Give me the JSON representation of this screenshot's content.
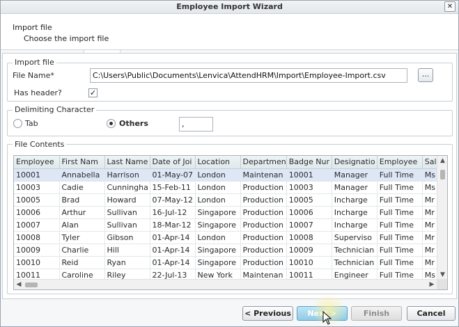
{
  "window": {
    "title": "Employee Import Wizard",
    "close_glyph": "✕"
  },
  "header": {
    "title": "Import file",
    "subtitle": "Choose the import file"
  },
  "import_file": {
    "group_label": "Import file",
    "file_name_label": "File Name*",
    "file_name_value": "C:\\Users\\Public\\Documents\\Lenvica\\AttendHRM\\Import\\Employee-Import.csv",
    "browse_label": "...",
    "has_header_label": "Has header?",
    "has_header_checked": true
  },
  "delimiter": {
    "group_label": "Delimiting Character",
    "tab_label": "Tab",
    "others_label": "Others",
    "selected": "Others",
    "others_value": ","
  },
  "file_contents": {
    "group_label": "File Contents",
    "columns": [
      "Employee",
      "First Nam",
      "Last Name",
      "Date of Joi",
      "Location",
      "Departmen",
      "Badge Nur",
      "Designatio",
      "Employee",
      "Sal"
    ],
    "rows": [
      [
        "10001",
        "Annabella",
        "Harrison",
        "01-May-07",
        "London",
        "Maintenan",
        "10001",
        "Manager",
        "Full Time",
        "Ms"
      ],
      [
        "10003",
        "Cadie",
        "Cunningha",
        "15-Feb-11",
        "London",
        "Production",
        "10003",
        "Manager",
        "Full Time",
        "Ms"
      ],
      [
        "10005",
        "Brad",
        "Howard",
        "07-May-12",
        "London",
        "Production",
        "10005",
        "Incharge",
        "Full Time",
        "Mr"
      ],
      [
        "10006",
        "Arthur",
        "Sullivan",
        "16-Jul-12",
        "Singapore",
        "Production",
        "10006",
        "Incharge",
        "Full Time",
        "Mr"
      ],
      [
        "10007",
        "Alan",
        "Sullivan",
        "18-Mar-12",
        "Singapore",
        "Production",
        "10007",
        "Incharge",
        "Full Time",
        "Mr"
      ],
      [
        "10008",
        "Tyler",
        "Gibson",
        "01-Apr-14",
        "London",
        "Production",
        "10008",
        "Superviso",
        "Full Time",
        "Mr"
      ],
      [
        "10009",
        "Charlie",
        "Hill",
        "01-Apr-14",
        "Singapore",
        "Production",
        "10009",
        "Technician",
        "Full Time",
        "Mr"
      ],
      [
        "10010",
        "Reid",
        "Ryan",
        "01-Apr-14",
        "Singapore",
        "Production",
        "10010",
        "Technician",
        "Full Time",
        "Mr"
      ],
      [
        "10011",
        "Caroline",
        "Riley",
        "22-Jul-13",
        "New York",
        "Maintenan",
        "10011",
        "Engineer",
        "Full Time",
        "Ms"
      ]
    ]
  },
  "buttons": {
    "previous": "< Previous",
    "next": "Next >",
    "finish": "Finish",
    "cancel": "Cancel"
  },
  "colors": {
    "accent": "#8fcbe6",
    "selection": "#dde7f6",
    "border": "#abb2ba"
  }
}
